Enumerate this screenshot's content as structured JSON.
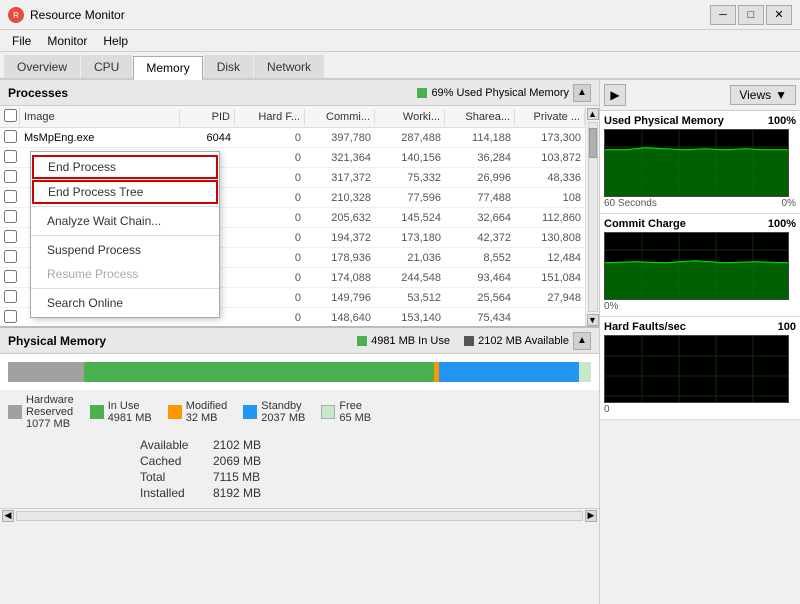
{
  "window": {
    "title": "Resource Monitor",
    "icon": "●",
    "controls": {
      "minimize": "─",
      "maximize": "□",
      "close": "✕"
    }
  },
  "menu": {
    "items": [
      "File",
      "Monitor",
      "Help"
    ]
  },
  "tabs": {
    "items": [
      "Overview",
      "CPU",
      "Memory",
      "Disk",
      "Network"
    ],
    "active": "Memory"
  },
  "processes": {
    "title": "Processes",
    "status": "69% Used Physical Memory",
    "columns": {
      "checkbox": "",
      "image": "Image",
      "pid": "PID",
      "hard_faults": "Hard F...",
      "commit": "Commi...",
      "working": "Worki...",
      "shareable": "Sharea...",
      "private": "Private ..."
    },
    "rows": [
      {
        "image": "MsMpEng.exe",
        "pid": "6044",
        "hard_faults": "0",
        "commit": "397,780",
        "working": "287,488",
        "shareable": "114,188",
        "private": "173,300"
      },
      {
        "image": "",
        "pid": "",
        "hard_faults": "0",
        "commit": "321,364",
        "working": "140,156",
        "shareable": "36,284",
        "private": "103,872"
      },
      {
        "image": "",
        "pid": "",
        "hard_faults": "0",
        "commit": "317,372",
        "working": "75,332",
        "shareable": "26,996",
        "private": "48,336"
      },
      {
        "image": "",
        "pid": "",
        "hard_faults": "0",
        "commit": "210,328",
        "working": "77,596",
        "shareable": "77,488",
        "private": "108"
      },
      {
        "image": "",
        "pid": "",
        "hard_faults": "0",
        "commit": "205,632",
        "working": "145,524",
        "shareable": "32,664",
        "private": "112,860"
      },
      {
        "image": "",
        "pid": "",
        "hard_faults": "0",
        "commit": "194,372",
        "working": "173,180",
        "shareable": "42,372",
        "private": "130,808"
      },
      {
        "image": "",
        "pid": "",
        "hard_faults": "0",
        "commit": "178,936",
        "working": "21,036",
        "shareable": "8,552",
        "private": "12,484"
      },
      {
        "image": "",
        "pid": "",
        "hard_faults": "0",
        "commit": "174,088",
        "working": "244,548",
        "shareable": "93,464",
        "private": "151,084"
      },
      {
        "image": "",
        "pid": "",
        "hard_faults": "0",
        "commit": "149,796",
        "working": "53,512",
        "shareable": "25,564",
        "private": "27,948"
      },
      {
        "image": "",
        "pid": "",
        "hard_faults": "0",
        "commit": "148,640",
        "working": "153,140",
        "shareable": "75,434",
        "private": ""
      }
    ]
  },
  "context_menu": {
    "items": [
      {
        "label": "End Process",
        "highlighted": true
      },
      {
        "label": "End Process Tree",
        "highlighted": true
      },
      {
        "label": "Analyze Wait Chain...",
        "highlighted": false
      },
      {
        "label": "Suspend Process",
        "highlighted": false
      },
      {
        "label": "Resume Process",
        "highlighted": false,
        "disabled": true
      },
      {
        "label": "Search Online",
        "highlighted": false
      }
    ]
  },
  "physical_memory": {
    "title": "Physical Memory",
    "in_use": "4981 MB In Use",
    "available": "2102 MB Available",
    "legend": [
      {
        "label": "Hardware\nReserved\n1077 MB",
        "color": "#a0a0a0"
      },
      {
        "label": "In Use\n4981 MB",
        "color": "#4caf50"
      },
      {
        "label": "Modified\n32 MB",
        "color": "#ff9800"
      },
      {
        "label": "Standby\n2037 MB",
        "color": "#2196f3"
      },
      {
        "label": "Free\n65 MB",
        "color": "#c8e6c9"
      }
    ],
    "bar": {
      "hardware_reserved_pct": 13,
      "in_use_pct": 60,
      "modified_pct": 1,
      "standby_pct": 24,
      "free_pct": 2
    },
    "stats": {
      "available_label": "Available",
      "available_value": "2102 MB",
      "cached_label": "Cached",
      "cached_value": "2069 MB",
      "total_label": "Total",
      "total_value": "7115 MB",
      "installed_label": "Installed",
      "installed_value": "8192 MB"
    }
  },
  "right_panel": {
    "nav_icon": "▶",
    "views_label": "Views",
    "views_arrow": "▼",
    "graphs": [
      {
        "title": "Used Physical Memory",
        "percent": "100%",
        "bottom_left": "60 Seconds",
        "bottom_right": "0%"
      },
      {
        "title": "Commit Charge",
        "percent": "100%",
        "bottom_right": "0%"
      },
      {
        "title": "Hard Faults/sec",
        "percent": "100",
        "bottom_right": "0"
      }
    ]
  }
}
